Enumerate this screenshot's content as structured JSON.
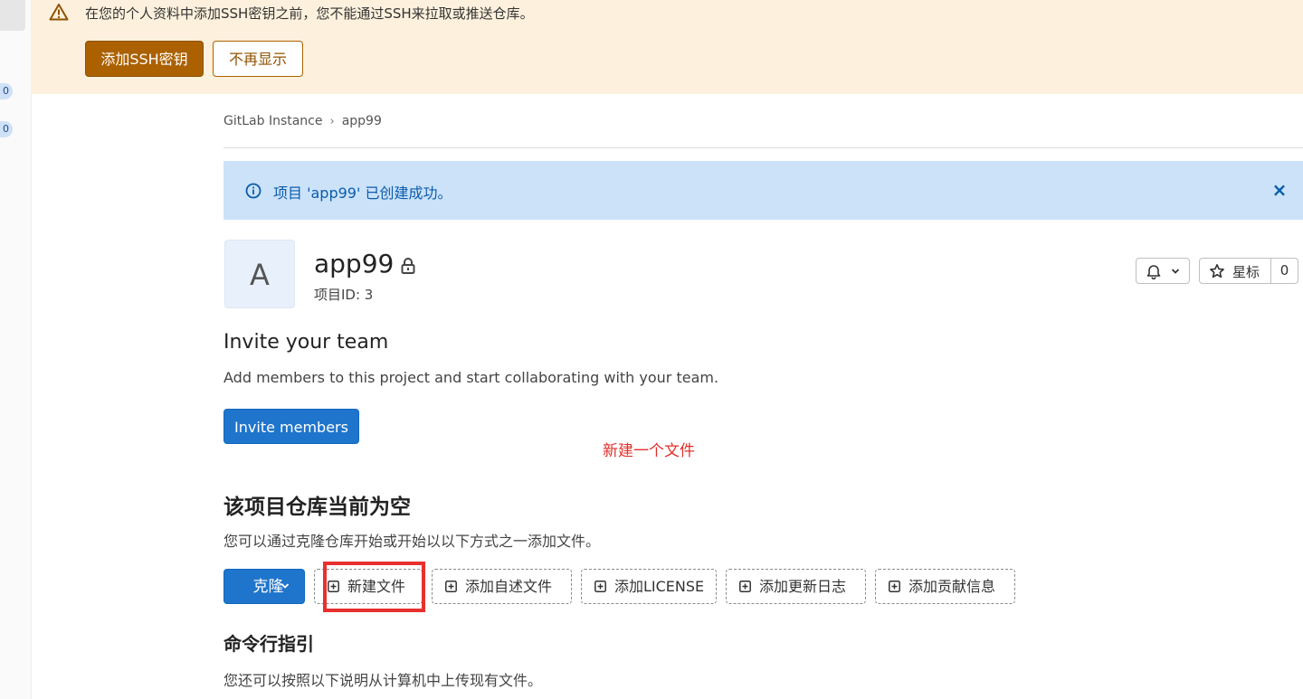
{
  "sidebar": {
    "badges": [
      "0",
      "0"
    ]
  },
  "ssh_banner": {
    "message": "在您的个人资料中添加SSH密钥之前，您不能通过SSH来拉取或推送仓库。",
    "add_key_label": "添加SSH密钥",
    "dismiss_label": "不再显示"
  },
  "breadcrumb": {
    "root": "GitLab Instance",
    "separator": "›",
    "current": "app99"
  },
  "alert": {
    "message": "项目 'app99' 已创建成功。",
    "close": "×"
  },
  "project": {
    "avatar_letter": "A",
    "name": "app99",
    "id_label": "项目ID: 3",
    "star_label": "星标",
    "star_count": "0"
  },
  "invite": {
    "title": "Invite your team",
    "description": "Add members to this project and start collaborating with your team.",
    "button_label": "Invite members"
  },
  "annotation": {
    "text": "新建一个文件"
  },
  "empty_repo": {
    "title": "该项目仓库当前为空",
    "description": "您可以通过克隆仓库开始或开始以以下方式之一添加文件。",
    "clone_label": "克隆",
    "actions": [
      "新建文件",
      "添加自述文件",
      "添加LICENSE",
      "添加更新日志",
      "添加贡献信息"
    ]
  },
  "cli": {
    "title": "命令行指引",
    "description": "您还可以按照以下说明从计算机中上传现有文件。"
  },
  "colors": {
    "warning_bg": "#fdf1dd",
    "warning_button": "#ab6100",
    "info_bg": "#cbe2f9",
    "primary": "#1f75cb",
    "annotation_red": "#e8312f"
  }
}
